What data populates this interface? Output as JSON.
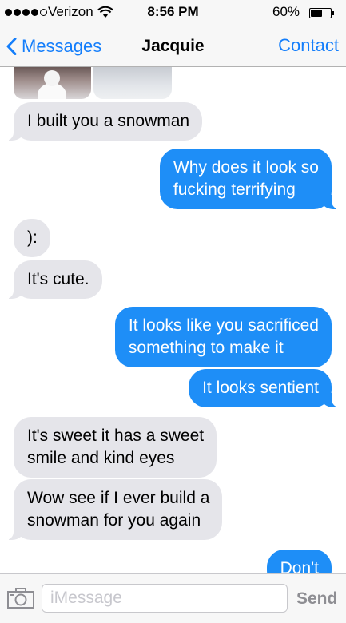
{
  "status_bar": {
    "carrier": "Verizon",
    "time": "8:56 PM",
    "battery_percent": "60%",
    "battery_level": 0.6,
    "signal_bars": 4,
    "signal_total": 5
  },
  "nav": {
    "back_label": "Messages",
    "title": "Jacquie",
    "contact_label": "Contact"
  },
  "messages": [
    {
      "from": "them",
      "type": "photos",
      "count": 2
    },
    {
      "from": "them",
      "text": "I built you a snowman"
    },
    {
      "from": "me",
      "lines": [
        "Why does it look so",
        "fucking terrifying"
      ]
    },
    {
      "from": "them",
      "text": "):"
    },
    {
      "from": "them",
      "text": "It's cute."
    },
    {
      "from": "me",
      "lines": [
        "It looks like you sacrificed",
        "something to make it"
      ]
    },
    {
      "from": "me",
      "text": "It looks sentient"
    },
    {
      "from": "them",
      "lines": [
        "It's sweet it has a sweet",
        "smile and kind eyes"
      ]
    },
    {
      "from": "them",
      "lines": [
        "Wow see if I ever build a",
        "snowman for you again"
      ]
    },
    {
      "from": "me",
      "text": "Don't"
    }
  ],
  "input": {
    "placeholder": "iMessage",
    "value": "",
    "send_label": "Send"
  },
  "colors": {
    "accent": "#147efb",
    "sent_bubble": "#1e8ef7",
    "received_bubble": "#e5e5ea",
    "bar_background": "#f7f7f7"
  },
  "icons": [
    "wifi-icon",
    "battery-icon",
    "back-chevron-icon",
    "camera-icon"
  ]
}
